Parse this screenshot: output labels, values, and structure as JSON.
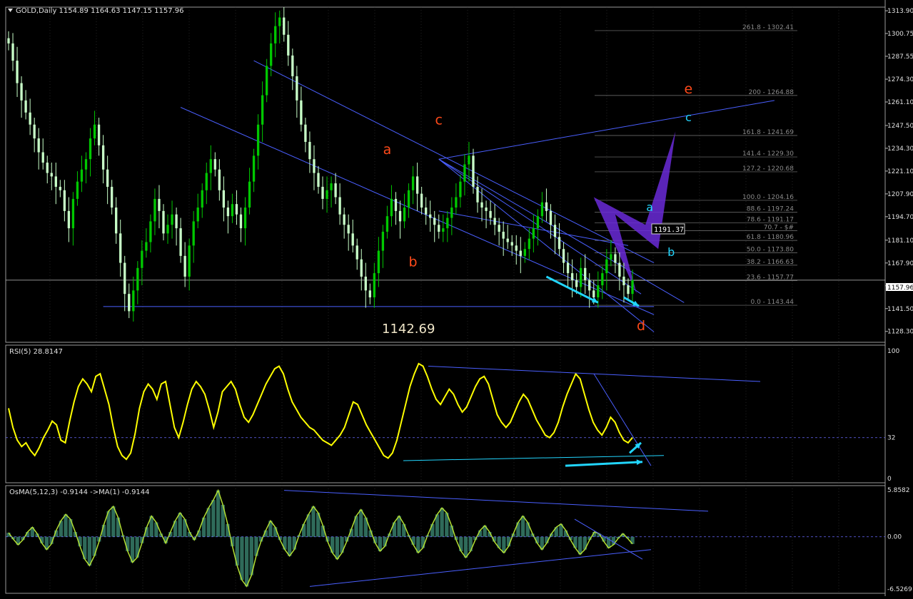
{
  "colors": {
    "background": "#000000",
    "grid": "#3a3a3a",
    "candle_up": "#00c800",
    "candle_down": "#c8ffc8",
    "price_line": "#c0c0c0",
    "trendline": "#4a5fff",
    "fib": "#7a7a7a",
    "fib_text": "#8a8a8a",
    "wave_orange": "#ff4a1a",
    "wave_cyan": "#22d6ff",
    "harmonic_fill": "#6a2ad8",
    "rsi": "#ffff00",
    "osma_hist": "#2f6b5a",
    "osma_signal": "#b4e033",
    "axis_text": "#e0e0e0"
  },
  "chart_data": [
    {
      "type": "candlestick",
      "panel": "main",
      "header": "GOLD,Daily  1154.89 1164.63 1147.15 1157.96",
      "yaxis_ticks": [
        "1313.90",
        "1300.75",
        "1287.55",
        "1274.30",
        "1261.10",
        "1247.50",
        "1234.30",
        "1221.10",
        "1207.90",
        "1194.70",
        "1181.10",
        "1167.90",
        "1154.70",
        "1141.50",
        "1128.30"
      ],
      "ylim": [
        1122,
        1316
      ],
      "close_series": [
        1295,
        1285,
        1272,
        1262,
        1255,
        1248,
        1240,
        1232,
        1226,
        1220,
        1218,
        1212,
        1210,
        1198,
        1188,
        1205,
        1215,
        1222,
        1228,
        1240,
        1248,
        1236,
        1222,
        1212,
        1200,
        1185,
        1168,
        1150,
        1140,
        1152,
        1165,
        1175,
        1180,
        1192,
        1205,
        1198,
        1185,
        1190,
        1196,
        1188,
        1172,
        1160,
        1178,
        1192,
        1200,
        1210,
        1220,
        1228,
        1222,
        1210,
        1200,
        1195,
        1202,
        1196,
        1188,
        1200,
        1215,
        1230,
        1248,
        1265,
        1282,
        1295,
        1305,
        1310,
        1300,
        1288,
        1276,
        1262,
        1248,
        1238,
        1228,
        1220,
        1212,
        1205,
        1210,
        1214,
        1206,
        1196,
        1190,
        1185,
        1178,
        1170,
        1160,
        1152,
        1148,
        1162,
        1175,
        1186,
        1195,
        1205,
        1198,
        1192,
        1200,
        1210,
        1218,
        1208,
        1200,
        1196,
        1194,
        1190,
        1186,
        1188,
        1194,
        1200,
        1206,
        1215,
        1225,
        1230,
        1212,
        1203,
        1200,
        1198,
        1194,
        1190,
        1186,
        1182,
        1180,
        1178,
        1175,
        1172,
        1176,
        1182,
        1188,
        1195,
        1203,
        1198,
        1190,
        1183,
        1176,
        1168,
        1162,
        1158,
        1154,
        1165,
        1158,
        1152,
        1148,
        1155,
        1162,
        1170,
        1173,
        1168,
        1160,
        1155,
        1150,
        1158
      ],
      "last_price": "1157.96",
      "price_level_label": "1142.69",
      "box_label": "1191.37",
      "fib_levels": [
        {
          "label": "261.8 - 1302.41",
          "value": 1302.41
        },
        {
          "label": "200 - 1264.88",
          "value": 1264.88
        },
        {
          "label": "161.8 - 1241.69",
          "value": 1241.69
        },
        {
          "label": "141.4 - 1229.30",
          "value": 1229.3
        },
        {
          "label": "127.2 - 1220.68",
          "value": 1220.68
        },
        {
          "label": "100.0 - 1204.16",
          "value": 1204.16
        },
        {
          "label": "88.6 - 1197.24",
          "value": 1197.24
        },
        {
          "label": "78.6 - 1191.17",
          "value": 1191.17
        },
        {
          "label": "70.7 - $#",
          "value": 1186.6
        },
        {
          "label": "61.8 - 1180.96",
          "value": 1180.96
        },
        {
          "label": "50.0 - 1173.80",
          "value": 1173.8
        },
        {
          "label": "38.2 - 1166.63",
          "value": 1166.63
        },
        {
          "label": "23.6 - 1157.77",
          "value": 1157.77
        },
        {
          "label": "0.0 - 1143.44",
          "value": 1143.44
        }
      ],
      "wave_labels": [
        {
          "text": "a",
          "color": "orange"
        },
        {
          "text": "b",
          "color": "orange"
        },
        {
          "text": "c",
          "color": "orange"
        },
        {
          "text": "d",
          "color": "orange"
        },
        {
          "text": "e",
          "color": "orange"
        },
        {
          "text": "a",
          "color": "cyan"
        },
        {
          "text": "b",
          "color": "cyan"
        },
        {
          "text": "c",
          "color": "cyan"
        }
      ]
    },
    {
      "type": "line",
      "panel": "rsi",
      "header": "RSI(5) 28.8147",
      "ylim": [
        0,
        100
      ],
      "yaxis_ticks": [
        "100",
        "32",
        "0"
      ],
      "level": 32,
      "values": [
        55,
        40,
        30,
        25,
        28,
        22,
        18,
        24,
        32,
        38,
        45,
        42,
        30,
        28,
        45,
        60,
        72,
        78,
        74,
        68,
        80,
        82,
        70,
        58,
        40,
        25,
        18,
        15,
        20,
        35,
        55,
        68,
        74,
        70,
        62,
        74,
        76,
        58,
        40,
        32,
        44,
        58,
        70,
        76,
        72,
        66,
        54,
        40,
        52,
        68,
        72,
        76,
        70,
        58,
        48,
        44,
        50,
        58,
        66,
        74,
        80,
        86,
        88,
        82,
        70,
        60,
        54,
        48,
        44,
        40,
        38,
        34,
        30,
        28,
        26,
        30,
        34,
        40,
        50,
        60,
        58,
        50,
        42,
        36,
        30,
        24,
        18,
        16,
        20,
        30,
        44,
        58,
        72,
        82,
        90,
        88,
        80,
        70,
        62,
        58,
        64,
        70,
        66,
        58,
        52,
        56,
        64,
        72,
        78,
        80,
        74,
        62,
        50,
        44,
        40,
        44,
        52,
        60,
        66,
        62,
        54,
        46,
        40,
        34,
        32,
        36,
        44,
        56,
        66,
        74,
        82,
        78,
        66,
        54,
        44,
        38,
        34,
        40,
        48,
        44,
        36,
        30,
        28,
        32
      ]
    },
    {
      "type": "bar",
      "panel": "osma",
      "header": "OsMA(5,12,3) -0.9144   ->MA(1) -0.9144",
      "ylim": [
        -6.5269,
        5.8582
      ],
      "yaxis_ticks": [
        "5.8582",
        "0.00",
        "-6.5269"
      ],
      "values": [
        0.5,
        -0.3,
        -1.0,
        -0.4,
        0.6,
        1.2,
        0.4,
        -0.8,
        -1.6,
        -0.9,
        0.8,
        2.0,
        2.8,
        2.2,
        0.6,
        -1.2,
        -2.8,
        -3.6,
        -2.4,
        -0.6,
        1.5,
        3.2,
        3.8,
        2.4,
        0.2,
        -1.8,
        -3.2,
        -2.6,
        -0.8,
        1.2,
        2.6,
        1.8,
        0.4,
        -0.8,
        0.6,
        2.0,
        3.0,
        2.2,
        0.6,
        -0.4,
        0.8,
        2.4,
        3.6,
        4.6,
        5.8,
        4.0,
        1.6,
        -1.2,
        -3.6,
        -5.4,
        -6.2,
        -4.8,
        -2.4,
        -0.6,
        0.8,
        2.0,
        1.2,
        -0.4,
        -1.6,
        -2.4,
        -1.6,
        0.2,
        1.6,
        2.8,
        3.8,
        3.0,
        1.4,
        -0.6,
        -2.0,
        -2.8,
        -2.0,
        -0.6,
        1.0,
        2.6,
        3.4,
        2.4,
        0.8,
        -0.8,
        -1.8,
        -1.2,
        0.4,
        1.8,
        2.6,
        1.6,
        0.2,
        -1.0,
        -2.0,
        -1.4,
        0.2,
        1.6,
        2.8,
        3.6,
        3.0,
        1.4,
        -0.4,
        -1.8,
        -2.6,
        -1.8,
        -0.4,
        0.8,
        1.4,
        0.6,
        -0.6,
        -1.4,
        -2.0,
        -1.2,
        0.4,
        1.8,
        2.6,
        1.8,
        0.4,
        -0.8,
        -1.6,
        -0.8,
        0.4,
        1.2,
        1.6,
        0.8,
        -0.4,
        -1.4,
        -2.2,
        -1.6,
        -0.4,
        0.6,
        0.4,
        -0.6,
        -1.4,
        -1.0,
        -0.2,
        0.4,
        -0.2,
        -0.9
      ]
    }
  ]
}
